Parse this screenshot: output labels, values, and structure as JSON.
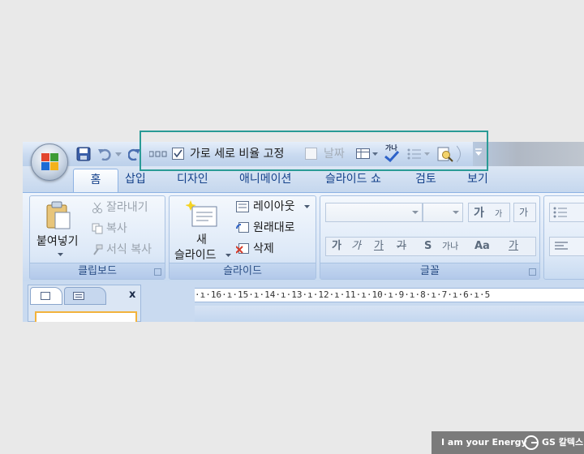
{
  "quick_access": {
    "checkbox_label": "가로 세로 비율 고정",
    "checkbox_checked": true,
    "date_label": "날짜",
    "date_checked": false,
    "spelling_glyph": "가나"
  },
  "tabs": [
    "홈",
    "삽입",
    "디자인",
    "애니메이션",
    "슬라이드 쇼",
    "검토",
    "보기"
  ],
  "ribbon": {
    "clipboard": {
      "paste": "붙여넣기",
      "cut": "잘라내기",
      "copy": "복사",
      "format_painter": "서식 복사",
      "label": "클립보드"
    },
    "slides": {
      "new_slide_line1": "새",
      "new_slide_line2": "슬라이드",
      "layout": "레이아웃",
      "reset": "원래대로",
      "delete": "삭제",
      "label": "슬라이드"
    },
    "font": {
      "grow": "가",
      "shrink": "가",
      "clear_format": "가",
      "bold": "가",
      "italic": "가",
      "underline": "가",
      "strike": "가",
      "shadow": "S",
      "spacing": "가나",
      "case": "Aa",
      "color": "가",
      "label": "글꼴"
    }
  },
  "ruler_text": "·ı·16·ı·15·ı·14·ı·13·ı·12·ı·11·ı·10·ı·9·ı·8·ı·7·ı·6·ı·5",
  "pane_close": "x",
  "watermark": {
    "slogan": "I am your Energy",
    "brand": "GS 칼텍스"
  },
  "colors": {
    "highlight": "#2a9b96",
    "ribbon_text": "#15428b"
  }
}
